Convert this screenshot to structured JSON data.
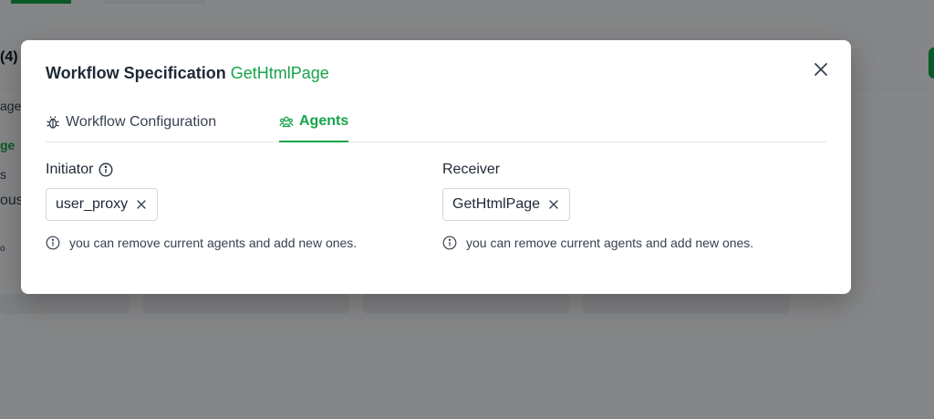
{
  "background": {
    "count_label": "(4)",
    "side_items": [
      "age",
      "ge",
      "s",
      "ous",
      "o"
    ]
  },
  "modal": {
    "title": "Workflow Specification",
    "title_highlight": "GetHtmlPage",
    "tabs": [
      {
        "label": "Workflow Configuration",
        "icon": "bug-icon",
        "active": false
      },
      {
        "label": "Agents",
        "icon": "users-icon",
        "active": true
      }
    ],
    "initiator": {
      "label": "Initiator",
      "agent": "user_proxy",
      "hint": "you can remove current agents and add new ones."
    },
    "receiver": {
      "label": "Receiver",
      "agent": "GetHtmlPage",
      "hint": "you can remove current agents and add new ones."
    }
  },
  "colors": {
    "accent": "#16a34a",
    "overlay": "rgba(0,0,0,0.45)",
    "text": "#1f2937"
  }
}
